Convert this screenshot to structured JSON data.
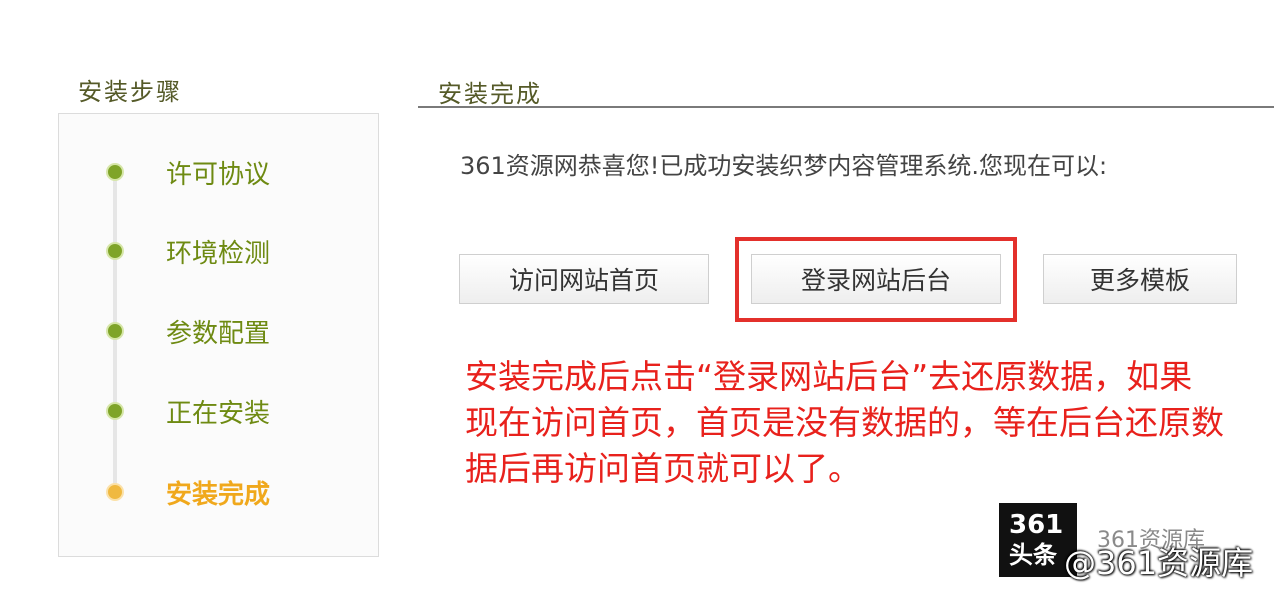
{
  "sidebar": {
    "title": "安装步骤",
    "steps": [
      {
        "label": "许可协议",
        "state": "done"
      },
      {
        "label": "环境检测",
        "state": "done"
      },
      {
        "label": "参数配置",
        "state": "done"
      },
      {
        "label": "正在安装",
        "state": "done"
      },
      {
        "label": "安装完成",
        "state": "current"
      }
    ]
  },
  "main": {
    "title": "安装完成",
    "message": "361资源网恭喜您!已成功安装织梦内容管理系统.您现在可以:",
    "buttons": {
      "visit_home": "访问网站首页",
      "login_admin": "登录网站后台",
      "more_templates": "更多模板"
    },
    "annotation": "安装完成后点击“登录网站后台”去还原数据，如果现在访问首页，首页是没有数据的，等在后台还原数据后再访问首页就可以了。"
  },
  "watermark": {
    "logo_number": "361",
    "logo_text": "头条",
    "channel": "361资源库",
    "handle": "@361资源库"
  },
  "colors": {
    "step_done": "#7fa428",
    "step_current": "#f0b940",
    "annotation_red": "#e8211c",
    "highlight_border": "#e3302b"
  }
}
